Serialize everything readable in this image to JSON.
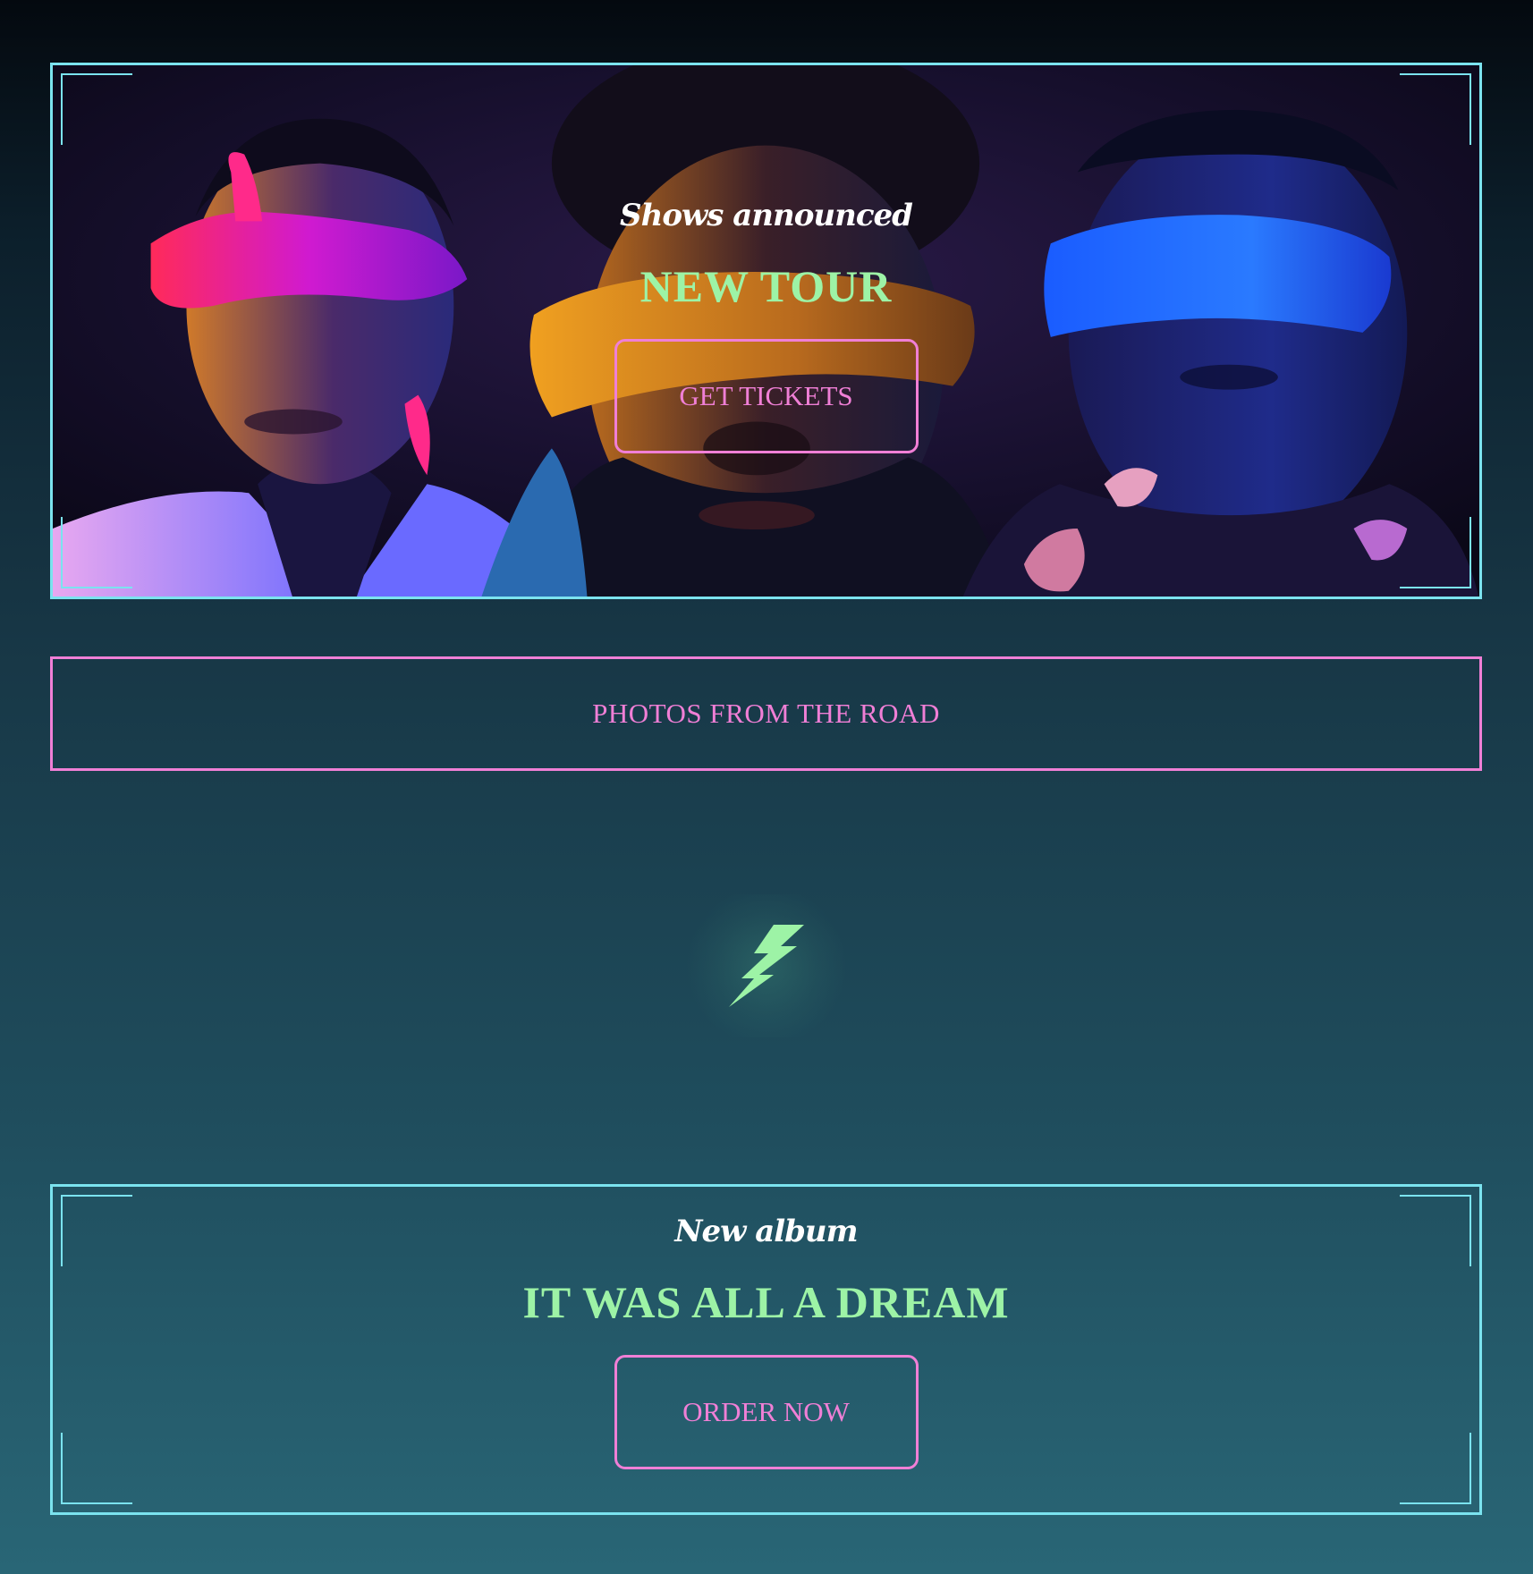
{
  "hero": {
    "eyebrow": "Shows announced",
    "title": "NEW TOUR",
    "button_label": "GET TICKETS"
  },
  "road_link": {
    "label": "PHOTOS FROM THE ROAD"
  },
  "divider": {
    "icon": "lightning-bolt-icon"
  },
  "album": {
    "eyebrow": "New album",
    "title": "IT WAS ALL A DREAM",
    "button_label": "ORDER NOW"
  },
  "colors": {
    "frame": "#7be3ef",
    "accent_pink": "#f07fd6",
    "accent_green": "#9df3a6",
    "text_white": "#ffffff"
  }
}
